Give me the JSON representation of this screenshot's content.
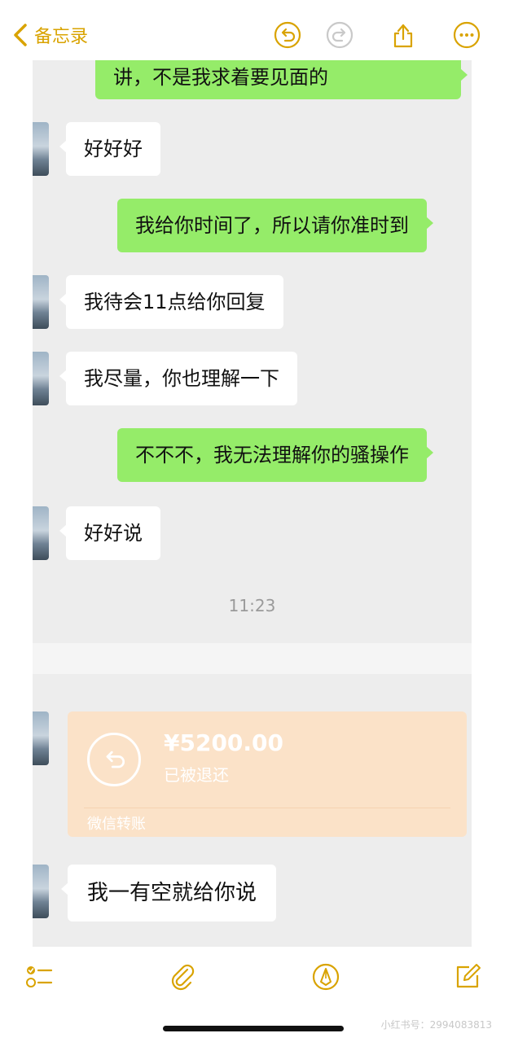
{
  "nav": {
    "back_label": "备忘录"
  },
  "chat_top": {
    "messages": [
      {
        "side": "out",
        "text": "讲，不是我求着要见面的"
      },
      {
        "side": "in",
        "text": "好好好"
      },
      {
        "side": "out",
        "text": "我给你时间了，所以请你准时到"
      },
      {
        "side": "in",
        "text": "我待会11点给你回复"
      },
      {
        "side": "in",
        "text": "我尽量，你也理解一下"
      },
      {
        "side": "out",
        "text": "不不不，我无法理解你的骚操作"
      },
      {
        "side": "in",
        "text": "好好说"
      }
    ],
    "timestamp": "11:23"
  },
  "chat_bottom": {
    "transfer": {
      "amount": "¥5200.00",
      "status": "已被退还",
      "kind": "微信转账"
    },
    "last_message": {
      "side": "in",
      "text": "我一有空就给你说"
    }
  },
  "watermark": "小红书号：2994083813",
  "colors": {
    "accent": "#d9a300",
    "bubble_out": "#95ec69",
    "bubble_in": "#ffffff",
    "chat_bg": "#ededed",
    "transfer_bg": "#fbe2c8"
  }
}
